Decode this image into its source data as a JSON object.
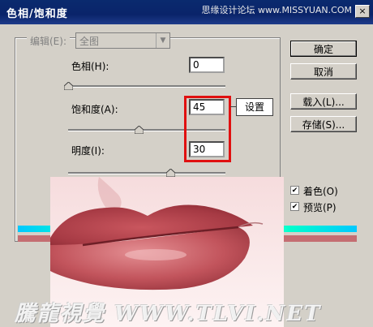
{
  "window": {
    "title": "色相/饱和度",
    "close_glyph": "×",
    "watermark_top": "思缘设计论坛 www.MISSYUAN.COM"
  },
  "edit": {
    "label": "编辑(E):",
    "value": "全图"
  },
  "hue": {
    "label": "色相(H):",
    "value": "0",
    "slider": 0.0
  },
  "saturation": {
    "label": "饱和度(A):",
    "value": "45",
    "slider": 0.45
  },
  "lightness": {
    "label": "明度(I):",
    "value": "30",
    "slider": 0.65
  },
  "annotation": {
    "callout": "设置",
    "color": "#e01010"
  },
  "buttons": {
    "ok": "确定",
    "cancel": "取消",
    "load": "载入(L)...",
    "save": "存储(S)..."
  },
  "checkboxes": {
    "colorize": {
      "label": "着色(O)",
      "checked": true
    },
    "preview": {
      "label": "预览(P)",
      "checked": true
    }
  },
  "watermark_bottom": "騰龍視覺 WWW.TLVI.NET"
}
